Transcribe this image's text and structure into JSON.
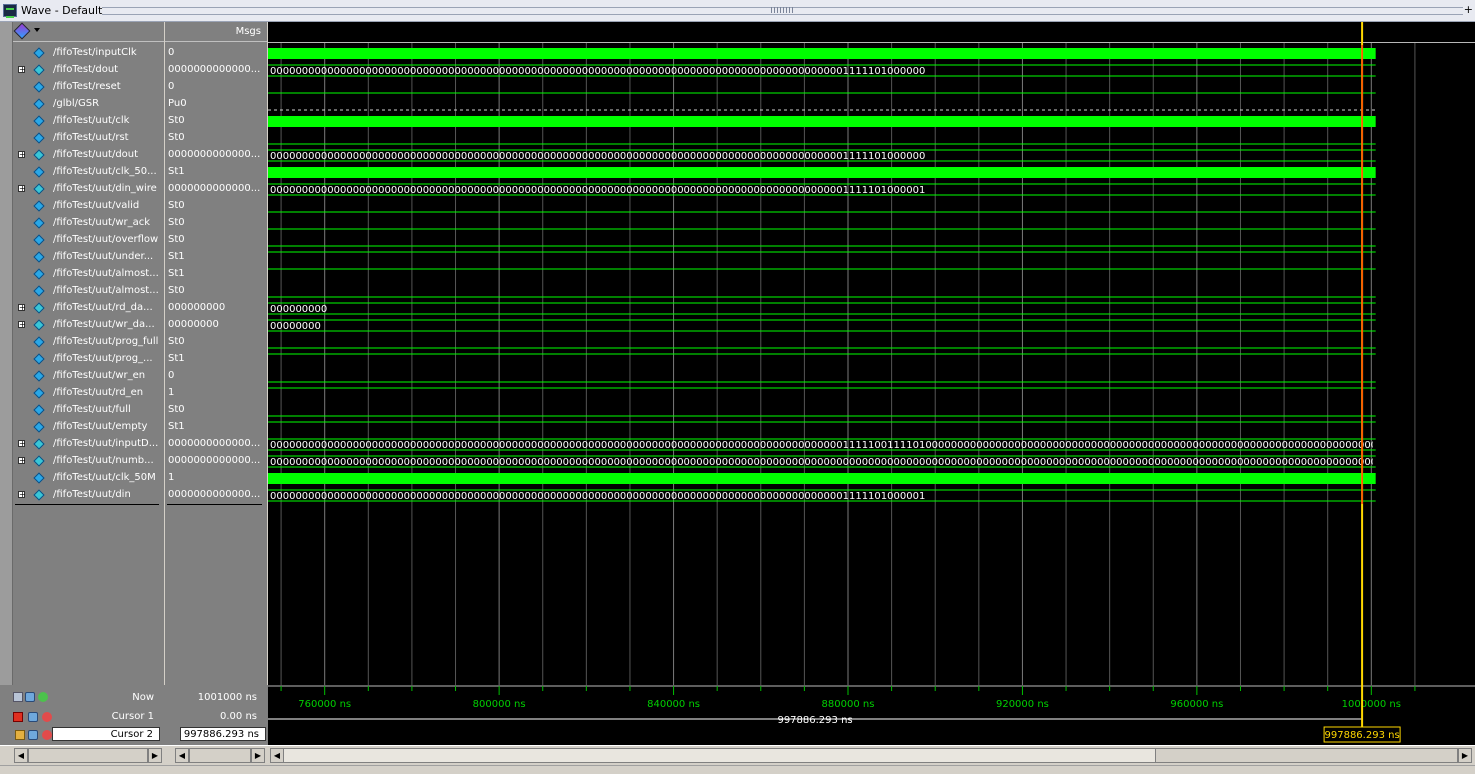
{
  "window": {
    "title": "Wave - Default",
    "more": "+"
  },
  "header": {
    "msgs_label": "Msgs"
  },
  "signals": [
    {
      "name": "/fifoTest/inputClk",
      "value": "0",
      "bus": false,
      "wave": "clock",
      "text": ""
    },
    {
      "name": "/fifoTest/dout",
      "value": "0000000000000...",
      "bus": true,
      "wave": "bus",
      "text": "0000000000000000000000000000000000000000000000000000000000000000000000000000000000000000001111101000000"
    },
    {
      "name": "/fifoTest/reset",
      "value": "0",
      "bus": false,
      "wave": "low",
      "text": ""
    },
    {
      "name": "/glbl/GSR",
      "value": "Pu0",
      "bus": false,
      "wave": "pull",
      "text": ""
    },
    {
      "name": "/fifoTest/uut/clk",
      "value": "St0",
      "bus": false,
      "wave": "clock",
      "text": ""
    },
    {
      "name": "/fifoTest/uut/rst",
      "value": "St0",
      "bus": false,
      "wave": "low",
      "text": ""
    },
    {
      "name": "/fifoTest/uut/dout",
      "value": "0000000000000...",
      "bus": true,
      "wave": "bus",
      "text": "0000000000000000000000000000000000000000000000000000000000000000000000000000000000000000001111101000000"
    },
    {
      "name": "/fifoTest/uut/clk_50...",
      "value": "St1",
      "bus": false,
      "wave": "clock",
      "text": ""
    },
    {
      "name": "/fifoTest/uut/din_wire",
      "value": "0000000000000...",
      "bus": true,
      "wave": "bus",
      "text": "0000000000000000000000000000000000000000000000000000000000000000000000000000000000000000001111101000001"
    },
    {
      "name": "/fifoTest/uut/valid",
      "value": "St0",
      "bus": false,
      "wave": "low",
      "text": ""
    },
    {
      "name": "/fifoTest/uut/wr_ack",
      "value": "St0",
      "bus": false,
      "wave": "low",
      "text": ""
    },
    {
      "name": "/fifoTest/uut/overflow",
      "value": "St0",
      "bus": false,
      "wave": "low",
      "text": ""
    },
    {
      "name": "/fifoTest/uut/under...",
      "value": "St1",
      "bus": false,
      "wave": "high",
      "text": ""
    },
    {
      "name": "/fifoTest/uut/almost...",
      "value": "St1",
      "bus": false,
      "wave": "high",
      "text": ""
    },
    {
      "name": "/fifoTest/uut/almost...",
      "value": "St0",
      "bus": false,
      "wave": "low",
      "text": ""
    },
    {
      "name": "/fifoTest/uut/rd_da...",
      "value": "000000000",
      "bus": true,
      "wave": "bus",
      "text": "000000000"
    },
    {
      "name": "/fifoTest/uut/wr_da...",
      "value": "00000000",
      "bus": true,
      "wave": "bus",
      "text": "00000000"
    },
    {
      "name": "/fifoTest/uut/prog_full",
      "value": "St0",
      "bus": false,
      "wave": "low",
      "text": ""
    },
    {
      "name": "/fifoTest/uut/prog_...",
      "value": "St1",
      "bus": false,
      "wave": "high",
      "text": ""
    },
    {
      "name": "/fifoTest/uut/wr_en",
      "value": "0",
      "bus": false,
      "wave": "low",
      "text": ""
    },
    {
      "name": "/fifoTest/uut/rd_en",
      "value": "1",
      "bus": false,
      "wave": "high",
      "text": ""
    },
    {
      "name": "/fifoTest/uut/full",
      "value": "St0",
      "bus": false,
      "wave": "low",
      "text": ""
    },
    {
      "name": "/fifoTest/uut/empty",
      "value": "St1",
      "bus": false,
      "wave": "high",
      "text": ""
    },
    {
      "name": "/fifoTest/uut/inputD...",
      "value": "0000000000000...",
      "bus": true,
      "wave": "bus",
      "text": "0000000000000000000000000000000000000000000000000000000000000000000000000000000000000000001111100111101000000000000000000000000000000000000000000000000000000000000000000000000000000000000000..."
    },
    {
      "name": "/fifoTest/uut/numb...",
      "value": "0000000000000...",
      "bus": true,
      "wave": "bus",
      "text": "000000000000000000000000000000000000000000000000000000000000000000000000000000000000000000000000000000000000000000000000000000000000000000000000000000000000000000000000000000000000000000000..."
    },
    {
      "name": "/fifoTest/uut/clk_50M",
      "value": "1",
      "bus": false,
      "wave": "clock",
      "text": ""
    },
    {
      "name": "/fifoTest/uut/din",
      "value": "0000000000000...",
      "bus": true,
      "wave": "bus",
      "text": "0000000000000000000000000000000000000000000000000000000000000000000000000000000000000000001111101000001"
    }
  ],
  "timeline": {
    "ticks": [
      "760000 ns",
      "800000 ns",
      "840000 ns",
      "880000 ns",
      "920000 ns",
      "960000 ns",
      "1000000 ns"
    ],
    "tick_values_ns": [
      760000,
      800000,
      840000,
      880000,
      920000,
      960000,
      1000000
    ],
    "view_start_ns": 747000,
    "view_end_ns": 1013000,
    "signal_end_ns": 1001000
  },
  "bottom": {
    "now_label": "Now",
    "now_value": "1001000 ns",
    "cursor1_label": "Cursor 1",
    "cursor1_value": "0.00 ns",
    "cursor2_label": "Cursor 2",
    "cursor2_value": "997886.293 ns",
    "cursor2_time_ns": 997886.293,
    "cursor_delta_label": "997886.293 ns",
    "cursor_flag": "997886.293 ns"
  },
  "colors": {
    "wave": "#00ff00",
    "background": "#000000",
    "cursor": "#ffd700",
    "gridline": "#808080",
    "marker": "#ff0000"
  }
}
